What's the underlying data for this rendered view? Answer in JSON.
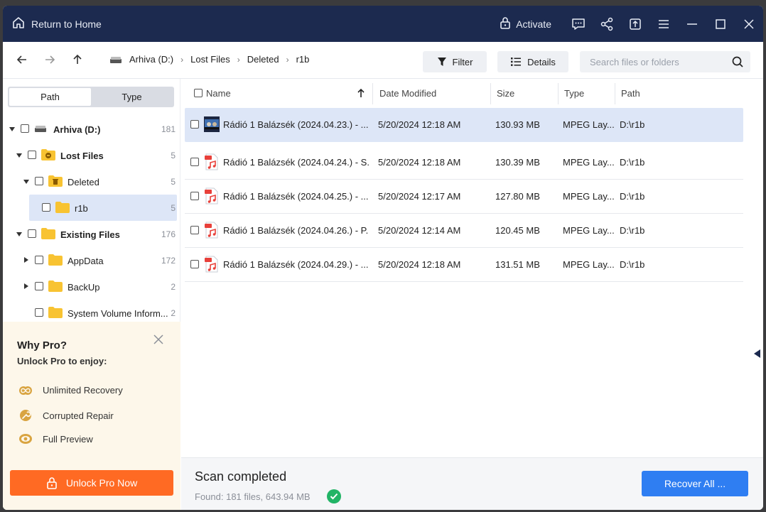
{
  "titlebar": {
    "home_label": "Return to Home",
    "activate_label": "Activate",
    "icons": [
      "feedback-icon",
      "share-icon",
      "upload-icon",
      "menu-icon",
      "minimize-icon",
      "maximize-icon",
      "close-icon"
    ]
  },
  "toolbar": {
    "breadcrumbs": [
      "Arhiva (D:)",
      "Lost Files",
      "Deleted",
      "r1b"
    ],
    "filter_label": "Filter",
    "details_label": "Details",
    "search_placeholder": "Search files or folders"
  },
  "sidebar": {
    "tabs": [
      "Path",
      "Type"
    ],
    "active_tab": "Path",
    "tree": [
      {
        "label": "Arhiva (D:)",
        "count": "181",
        "bold": true
      },
      {
        "label": "Lost Files",
        "count": "5",
        "bold": true
      },
      {
        "label": "Deleted",
        "count": "5",
        "bold": false
      },
      {
        "label": "r1b",
        "count": "5",
        "bold": false
      },
      {
        "label": "Existing Files",
        "count": "176",
        "bold": true
      },
      {
        "label": "AppData",
        "count": "172",
        "bold": false
      },
      {
        "label": "BackUp",
        "count": "2",
        "bold": false
      },
      {
        "label": "System Volume Inform...",
        "count": "2",
        "bold": false
      }
    ]
  },
  "promo": {
    "title": "Why Pro?",
    "subtitle": "Unlock Pro to enjoy:",
    "features": [
      "Unlimited Recovery",
      "Corrupted Repair",
      "Full Preview"
    ],
    "button_label": "Unlock Pro Now"
  },
  "table": {
    "headers": {
      "name": "Name",
      "date": "Date Modified",
      "size": "Size",
      "type": "Type",
      "path": "Path"
    },
    "rows": [
      {
        "name": "Rádió 1 Balázsék (2024.04.23.) - ...",
        "date": "5/20/2024 12:18 AM",
        "size": "130.93 MB",
        "type": "MPEG Lay...",
        "path": "D:\\r1b"
      },
      {
        "name": "Rádió 1 Balázsék (2024.04.24.) - S...",
        "date": "5/20/2024 12:18 AM",
        "size": "130.39 MB",
        "type": "MPEG Lay...",
        "path": "D:\\r1b"
      },
      {
        "name": "Rádió 1 Balázsék (2024.04.25.) - ...",
        "date": "5/20/2024 12:17 AM",
        "size": "127.80 MB",
        "type": "MPEG Lay...",
        "path": "D:\\r1b"
      },
      {
        "name": "Rádió 1 Balázsék (2024.04.26.) - P...",
        "date": "5/20/2024 12:14 AM",
        "size": "120.45 MB",
        "type": "MPEG Lay...",
        "path": "D:\\r1b"
      },
      {
        "name": "Rádió 1 Balázsék (2024.04.29.) - ...",
        "date": "5/20/2024 12:18 AM",
        "size": "131.51 MB",
        "type": "MPEG Lay...",
        "path": "D:\\r1b"
      }
    ]
  },
  "status": {
    "title": "Scan completed",
    "found": "Found: 181 files, 643.94 MB",
    "recover_label": "Recover All ..."
  },
  "colors": {
    "titlebar": "#1c2a4f",
    "accent_blue": "#2f7ef2",
    "accent_orange": "#ff6a23",
    "selection": "#dde6f7",
    "folder": "#f8c332",
    "success": "#22b466"
  }
}
